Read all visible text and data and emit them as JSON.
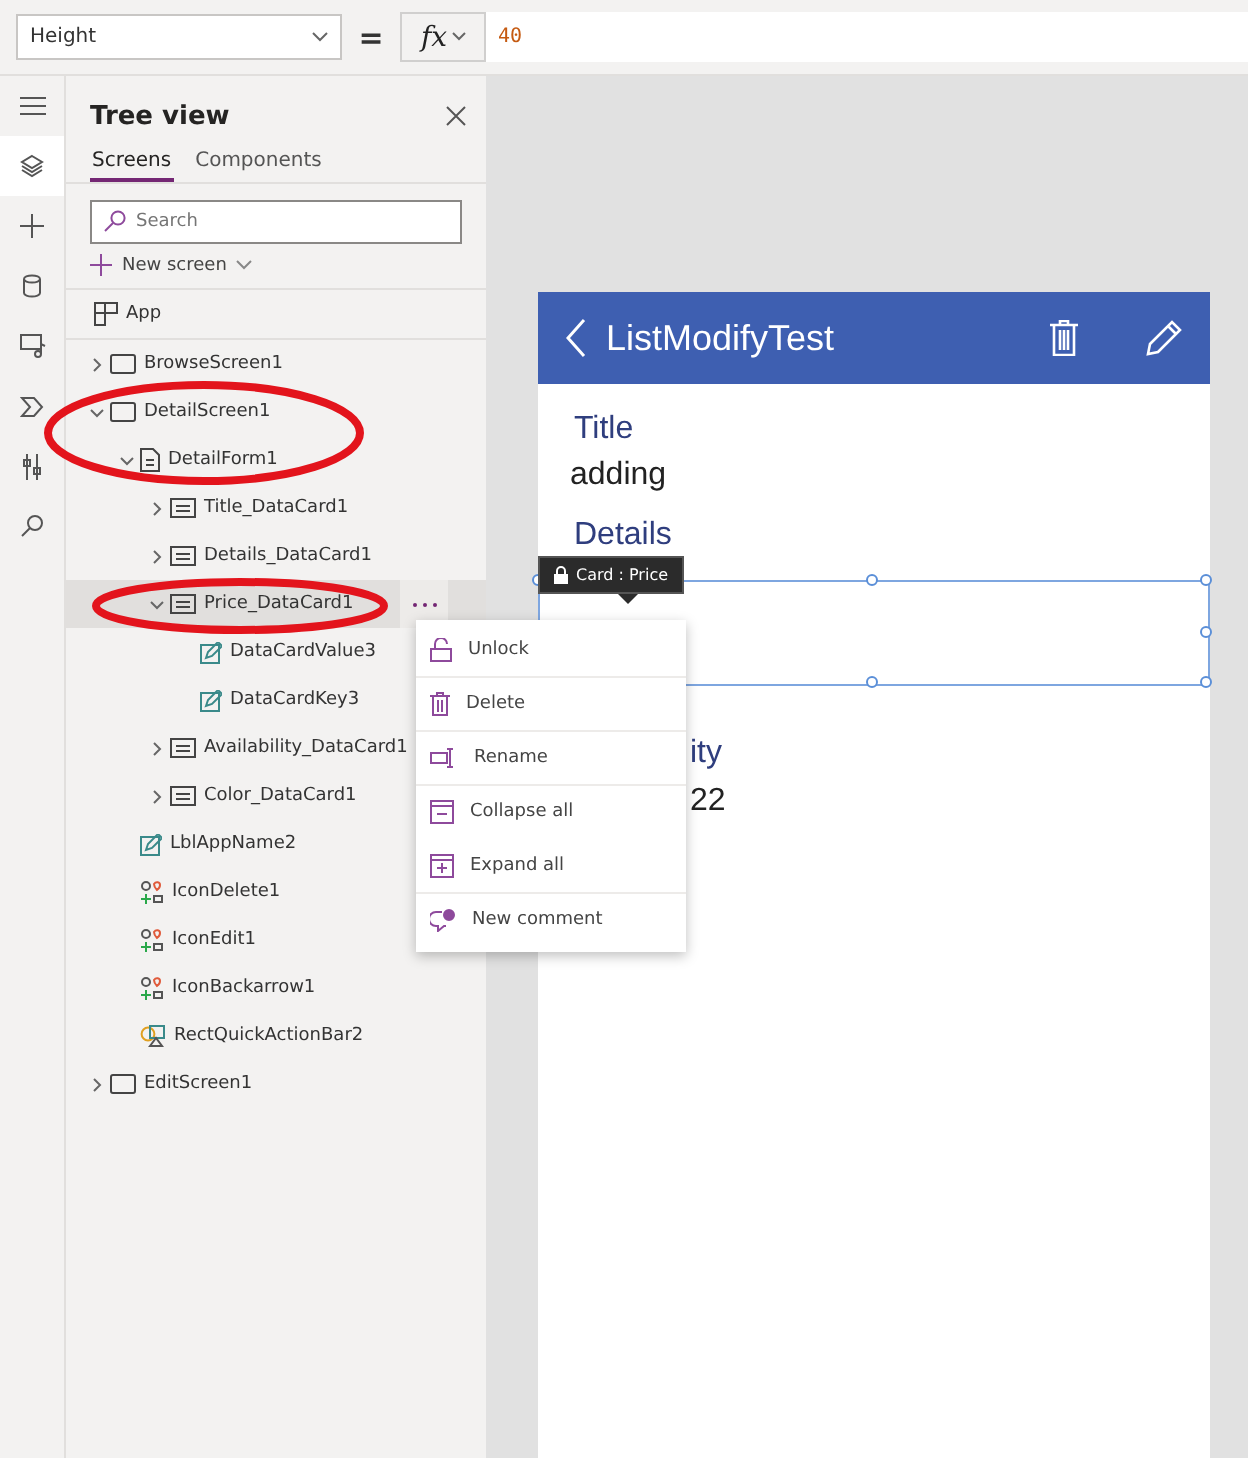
{
  "formula_bar": {
    "property": "Height",
    "equals": "=",
    "fx": "fx",
    "formula": "40"
  },
  "rail": [
    {
      "kind": "menu",
      "selected": false
    },
    {
      "kind": "layers",
      "selected": true
    },
    {
      "kind": "plus",
      "selected": false
    },
    {
      "kind": "data",
      "selected": false
    },
    {
      "kind": "media",
      "selected": false
    },
    {
      "kind": "flow",
      "selected": false
    },
    {
      "kind": "tools",
      "selected": false
    },
    {
      "kind": "search",
      "selected": false
    }
  ],
  "tree_view": {
    "title": "Tree view",
    "tabs": [
      {
        "label": "Screens",
        "selected": true
      },
      {
        "label": "Components",
        "selected": false
      }
    ],
    "search": {
      "placeholder": "Search"
    },
    "new_screen": "New screen",
    "app": {
      "label": "App"
    },
    "items": [
      {
        "kind": "screen",
        "label": "BrowseScreen1",
        "expanded": false,
        "selected": false
      },
      {
        "kind": "screen",
        "label": "DetailScreen1",
        "expanded": true,
        "selected": false,
        "circled": true,
        "children": [
          {
            "kind": "form",
            "label": "DetailForm1",
            "expanded": true,
            "selected": false,
            "children": [
              {
                "kind": "card",
                "label": "Title_DataCard1",
                "expanded": false,
                "selected": false
              },
              {
                "kind": "card",
                "label": "Details_DataCard1",
                "expanded": false,
                "selected": false
              },
              {
                "kind": "card",
                "label": "Price_DataCard1",
                "expanded": true,
                "selected": true,
                "circled": true,
                "children": [
                  {
                    "kind": "input",
                    "label": "DataCardValue3",
                    "selected": false
                  },
                  {
                    "kind": "input",
                    "label": "DataCardKey3",
                    "selected": false
                  }
                ]
              },
              {
                "kind": "card",
                "label": "Availability_DataCard1",
                "expanded": false,
                "selected": false
              },
              {
                "kind": "card",
                "label": "Color_DataCard1",
                "expanded": false,
                "selected": false
              }
            ]
          },
          {
            "kind": "input",
            "label": "LblAppName2",
            "selected": false
          },
          {
            "kind": "icon",
            "label": "IconDelete1",
            "selected": false
          },
          {
            "kind": "icon",
            "label": "IconEdit1",
            "selected": false
          },
          {
            "kind": "icon",
            "label": "IconBackarrow1",
            "selected": false
          },
          {
            "kind": "rect",
            "label": "RectQuickActionBar2",
            "selected": false
          }
        ]
      },
      {
        "kind": "screen",
        "label": "EditScreen1",
        "expanded": false,
        "selected": false
      }
    ]
  },
  "context_menu": [
    {
      "kind": "unlock",
      "label": "Unlock",
      "divider_after": true
    },
    {
      "kind": "delete",
      "label": "Delete",
      "divider_after": true
    },
    {
      "kind": "rename",
      "label": "Rename",
      "divider_after": true
    },
    {
      "kind": "collapse",
      "label": "Collapse all",
      "divider_after": false
    },
    {
      "kind": "expand",
      "label": "Expand all",
      "divider_after": true
    },
    {
      "kind": "comment",
      "label": "New comment",
      "divider_after": false
    }
  ],
  "canvas": {
    "header": {
      "title": "ListModifyTest"
    },
    "tooltip": "Card : Price",
    "fields": [
      {
        "kind": "label",
        "text": "Title"
      },
      {
        "kind": "value",
        "text": "adding"
      },
      {
        "kind": "label",
        "text": "Details"
      }
    ],
    "partial_fields": [
      {
        "kind": "label",
        "text": "ity"
      },
      {
        "kind": "value",
        "text": "22"
      }
    ]
  }
}
